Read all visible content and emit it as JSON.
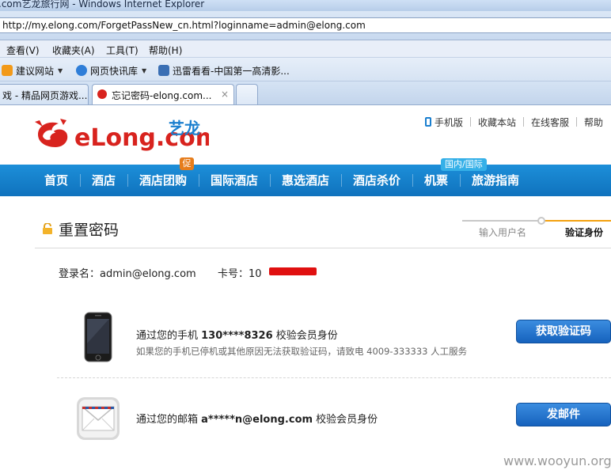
{
  "browser": {
    "window_title": ".com艺龙旅行网 - Windows Internet Explorer",
    "url": "http://my.elong.com/ForgetPassNew_cn.html?loginname=admin@elong.com",
    "menu": [
      "查看(V)",
      "收藏夹(A)",
      "工具(T)",
      "帮助(H)"
    ],
    "favorites": [
      {
        "label": "建议网站",
        "icon": "suggested-sites-icon"
      },
      {
        "label": "网页快讯库",
        "icon": "web-slice-icon"
      },
      {
        "label": "迅雷看看-中国第一高清影...",
        "icon": "xunlei-icon"
      }
    ],
    "tabs": [
      {
        "label": "戏 - 精品网页游戏..."
      },
      {
        "label": "忘记密码-elong.com...",
        "close": "×"
      }
    ]
  },
  "header": {
    "logo_text": "eLong.com",
    "logo_cn": "艺龙",
    "top_links": [
      "手机版",
      "收藏本站",
      "在线客服",
      "帮助"
    ]
  },
  "nav": {
    "items": [
      "首页",
      "酒店",
      "酒店团购",
      "国际酒店",
      "惠选酒店",
      "酒店杀价",
      "机票",
      "旅游指南"
    ],
    "badge_promo": "促",
    "badge_intl": "国内/国际"
  },
  "reset": {
    "title": "重置密码",
    "steps": [
      "输入用户名",
      "验证身份"
    ],
    "login_label": "登录名：",
    "login_value": "admin@elong.com",
    "card_label": "卡号：",
    "card_value": "10"
  },
  "options": {
    "phone": {
      "text_prefix": "通过您的手机 ",
      "number": "130****8326",
      "text_suffix": " 校验会员身份",
      "note": "如果您的手机已停机或其他原因无法获取验证码，请致电 4009-333333 人工服务",
      "button": "获取验证码"
    },
    "email": {
      "text_prefix": "通过您的邮箱 ",
      "address": "a*****n@elong.com",
      "text_suffix": " 校验会员身份",
      "button": "发邮件"
    }
  },
  "watermark": "www.wooyun.org",
  "colors": {
    "nav_blue": "#1d8fd9",
    "accent_orange": "#f3a10f",
    "button_blue": "#1662bd",
    "logo_red": "#d8231e"
  }
}
